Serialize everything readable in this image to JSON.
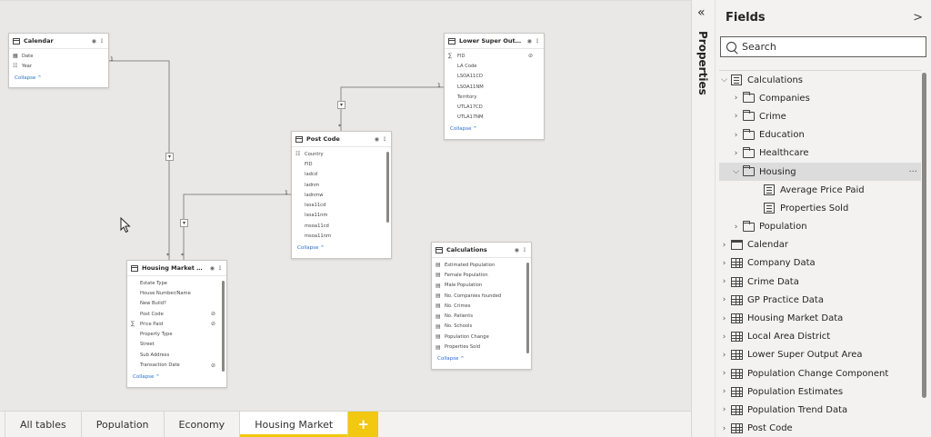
{
  "canvas": {
    "tables": [
      {
        "id": "calendar",
        "title": "Calendar",
        "fields": [
          {
            "name": "Date",
            "icon": "calendar-field-icon"
          },
          {
            "name": "Year",
            "icon": "hierarchy-icon"
          }
        ],
        "collapse": "Collapse ^"
      },
      {
        "id": "lsoa",
        "title": "Lower Super Output ...",
        "fields": [
          {
            "name": "FID",
            "icon": "sigma-icon",
            "hidden": true
          },
          {
            "name": "LA Code"
          },
          {
            "name": "LSOA11CD"
          },
          {
            "name": "LSOA11NM"
          },
          {
            "name": "Territory"
          },
          {
            "name": "UTLA17CD"
          },
          {
            "name": "UTLA17NM"
          }
        ],
        "collapse": "Collapse ^"
      },
      {
        "id": "postcode",
        "title": "Post Code",
        "fields": [
          {
            "name": "Country",
            "icon": "hierarchy-icon"
          },
          {
            "name": "FID"
          },
          {
            "name": "ladcd"
          },
          {
            "name": "ladnm"
          },
          {
            "name": "ladnmw"
          },
          {
            "name": "lsoa11cd"
          },
          {
            "name": "lsoa11nm"
          },
          {
            "name": "msoa11cd"
          },
          {
            "name": "msoa11nm"
          }
        ],
        "collapse": "Collapse ^"
      },
      {
        "id": "housing",
        "title": "Housing Market Data",
        "fields": [
          {
            "name": "Estate Type"
          },
          {
            "name": "House Number/Name"
          },
          {
            "name": "New Build?"
          },
          {
            "name": "Post Code",
            "hidden": true
          },
          {
            "name": "Price Paid",
            "icon": "sigma-icon",
            "hidden": true
          },
          {
            "name": "Property Type"
          },
          {
            "name": "Street"
          },
          {
            "name": "Sub Address"
          },
          {
            "name": "Transaction Date",
            "hidden": true
          }
        ],
        "collapse": "Collapse ^"
      },
      {
        "id": "calcs",
        "title": "Calculations",
        "fields": [
          {
            "name": "Estimated Population",
            "icon": "measure-icon"
          },
          {
            "name": "Female Population",
            "icon": "measure-icon"
          },
          {
            "name": "Male Population",
            "icon": "measure-icon"
          },
          {
            "name": "No. Companies founded",
            "icon": "measure-icon"
          },
          {
            "name": "No. Crimes",
            "icon": "measure-icon"
          },
          {
            "name": "No. Patients",
            "icon": "measure-icon"
          },
          {
            "name": "No. Schools",
            "icon": "measure-icon"
          },
          {
            "name": "Population Change",
            "icon": "measure-icon"
          },
          {
            "name": "Properties Sold",
            "icon": "measure-icon"
          }
        ],
        "collapse": "Collapse ^"
      }
    ],
    "relationships": {
      "one": "1",
      "many": "*"
    }
  },
  "tabs": [
    {
      "label": "All tables"
    },
    {
      "label": "Population"
    },
    {
      "label": "Economy"
    },
    {
      "label": "Housing Market",
      "active": true
    }
  ],
  "add_tab_label": "+",
  "properties": {
    "collapse_glyph": "«",
    "label": "Properties"
  },
  "fields_pane": {
    "title": "Fields",
    "expand_glyph": ">",
    "search_placeholder": "Search",
    "tree": [
      {
        "label": "Calculations",
        "level": 0,
        "expanded": true,
        "icon": "calc-table-icon"
      },
      {
        "label": "Companies",
        "level": 1,
        "expanded": false,
        "icon": "folder-icon"
      },
      {
        "label": "Crime",
        "level": 1,
        "expanded": false,
        "icon": "folder-icon"
      },
      {
        "label": "Education",
        "level": 1,
        "expanded": false,
        "icon": "folder-icon"
      },
      {
        "label": "Healthcare",
        "level": 1,
        "expanded": false,
        "icon": "folder-icon"
      },
      {
        "label": "Housing",
        "level": 1,
        "expanded": true,
        "icon": "folder-icon",
        "selected": true
      },
      {
        "label": "Average Price Paid",
        "level": 2,
        "icon": "measure-icon"
      },
      {
        "label": "Properties Sold",
        "level": 2,
        "icon": "measure-icon"
      },
      {
        "label": "Population",
        "level": 1,
        "expanded": false,
        "icon": "folder-icon"
      },
      {
        "label": "Calendar",
        "level": 0,
        "expanded": false,
        "icon": "calendar-table-icon"
      },
      {
        "label": "Company Data",
        "level": 0,
        "expanded": false,
        "icon": "table-icon"
      },
      {
        "label": "Crime Data",
        "level": 0,
        "expanded": false,
        "icon": "table-icon"
      },
      {
        "label": "GP Practice Data",
        "level": 0,
        "expanded": false,
        "icon": "table-icon"
      },
      {
        "label": "Housing Market Data",
        "level": 0,
        "expanded": false,
        "icon": "table-icon"
      },
      {
        "label": "Local Area District",
        "level": 0,
        "expanded": false,
        "icon": "table-icon"
      },
      {
        "label": "Lower Super Output Area",
        "level": 0,
        "expanded": false,
        "icon": "table-icon"
      },
      {
        "label": "Population Change Component",
        "level": 0,
        "expanded": false,
        "icon": "table-icon"
      },
      {
        "label": "Population Estimates",
        "level": 0,
        "expanded": false,
        "icon": "table-icon"
      },
      {
        "label": "Population Trend Data",
        "level": 0,
        "expanded": false,
        "icon": "table-icon"
      },
      {
        "label": "Post Code",
        "level": 0,
        "expanded": false,
        "icon": "table-icon"
      }
    ]
  }
}
